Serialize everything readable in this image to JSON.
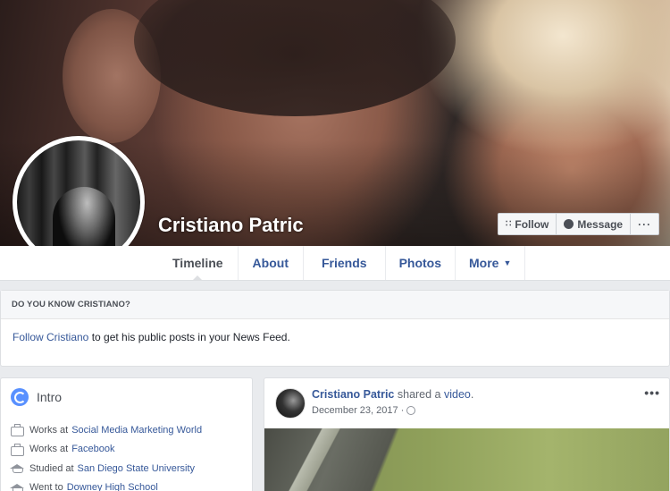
{
  "profile": {
    "name": "Cristiano Patric"
  },
  "actions": {
    "follow": "Follow",
    "message": "Message",
    "more": "···"
  },
  "tabs": [
    {
      "label": "Timeline"
    },
    {
      "label": "About"
    },
    {
      "label": "Friends"
    },
    {
      "label": "Photos"
    },
    {
      "label": "More"
    }
  ],
  "know": {
    "heading": "DO YOU KNOW CRISTIANO?",
    "link": "Follow Cristiano",
    "text": " to get his public posts in your News Feed."
  },
  "intro": {
    "title": "Intro",
    "items": [
      {
        "prefix": "Works at",
        "link": "Social Media Marketing World",
        "icon": "briefcase-icon"
      },
      {
        "prefix": "Works at",
        "link": "Facebook",
        "icon": "briefcase-icon"
      },
      {
        "prefix": "Studied at",
        "link": "San Diego State University",
        "icon": "graduation-cap-icon"
      },
      {
        "prefix": "Went to",
        "link": "Downey High School",
        "icon": "graduation-cap-icon"
      }
    ]
  },
  "post": {
    "author": "Cristiano Patric",
    "action": " shared a ",
    "object": "video",
    "suffix": ".",
    "date": "December 23, 2017 ·",
    "menu": "•••"
  },
  "colors": {
    "link": "#365899",
    "page_bg": "#e9ebee",
    "border": "#dddfe2"
  }
}
